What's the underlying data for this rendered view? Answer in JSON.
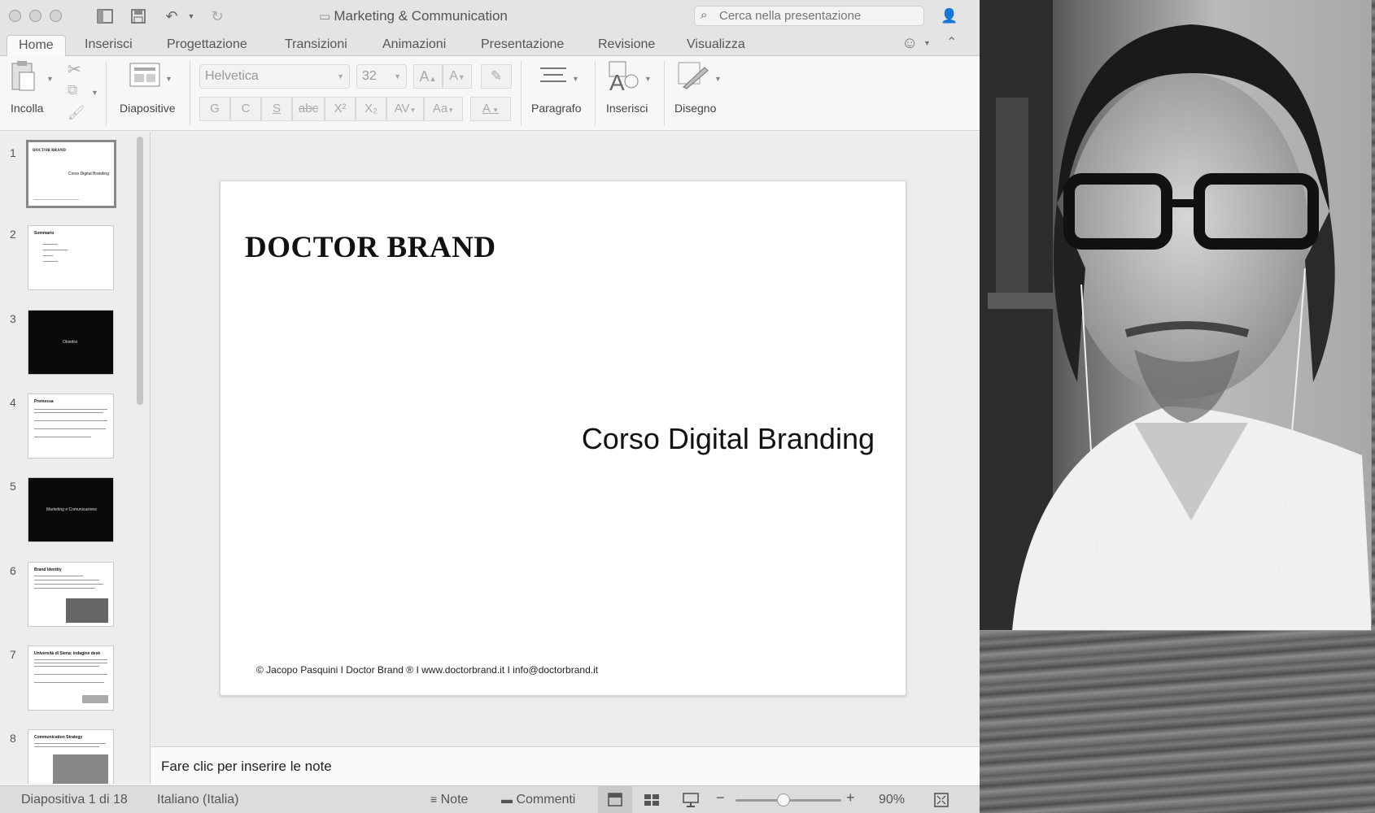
{
  "window": {
    "title": "Marketing & Communication"
  },
  "search": {
    "placeholder": "Cerca nella presentazione"
  },
  "tabs": [
    {
      "label": "Home",
      "active": true
    },
    {
      "label": "Inserisci"
    },
    {
      "label": "Progettazione"
    },
    {
      "label": "Transizioni"
    },
    {
      "label": "Animazioni"
    },
    {
      "label": "Presentazione"
    },
    {
      "label": "Revisione"
    },
    {
      "label": "Visualizza"
    }
  ],
  "ribbon": {
    "paste_label": "Incolla",
    "slides_label": "Diapositive",
    "font_name": "Helvetica",
    "font_size": "32",
    "bold": "G",
    "italic": "C",
    "underline": "S",
    "strike": "abc",
    "superscript": "X²",
    "subscript": "X₂",
    "spacing": "AV",
    "change_case": "Aa",
    "font_color": "A",
    "grow": "A",
    "shrink": "A",
    "paragraph_label": "Paragrafo",
    "insert_label": "Inserisci",
    "drawing_label": "Disegno"
  },
  "thumbnails": [
    {
      "num": "1",
      "title": "DOCTOR BRAND",
      "subtitle": "Corso Digital Branding",
      "dark": false,
      "selected": true
    },
    {
      "num": "2",
      "title": "Sommario",
      "dark": false
    },
    {
      "num": "3",
      "title": "Obiettivi",
      "dark": true
    },
    {
      "num": "4",
      "title": "Premessa",
      "dark": false
    },
    {
      "num": "5",
      "title": "Marketing e Comunicazione",
      "dark": true
    },
    {
      "num": "6",
      "title": "Brand Identity",
      "dark": false
    },
    {
      "num": "7",
      "title": "Università di Siena: indagine desk",
      "dark": false
    },
    {
      "num": "8",
      "title": "Communication Strategy",
      "dark": false
    }
  ],
  "slide": {
    "title": "DOCTOR BRAND",
    "subtitle": "Corso Digital Branding",
    "footer": "© Jacopo Pasquini I Doctor Brand ® I www.doctorbrand.it I info@doctorbrand.it"
  },
  "notes": {
    "placeholder": "Fare clic per inserire le note"
  },
  "status": {
    "slide_counter": "Diapositiva 1 di 18",
    "language": "Italiano (Italia)",
    "notes_label": "Note",
    "comments_label": "Commenti",
    "zoom": "90%",
    "zoom_value": 0.45
  },
  "icons": {
    "sidebar": "sidebar-icon",
    "save": "save-icon",
    "undo": "undo-icon",
    "redo": "redo-icon",
    "search": "search-icon",
    "share": "add-person-icon",
    "smiley": "smiley-icon",
    "collapse": "chevron-up-icon"
  }
}
